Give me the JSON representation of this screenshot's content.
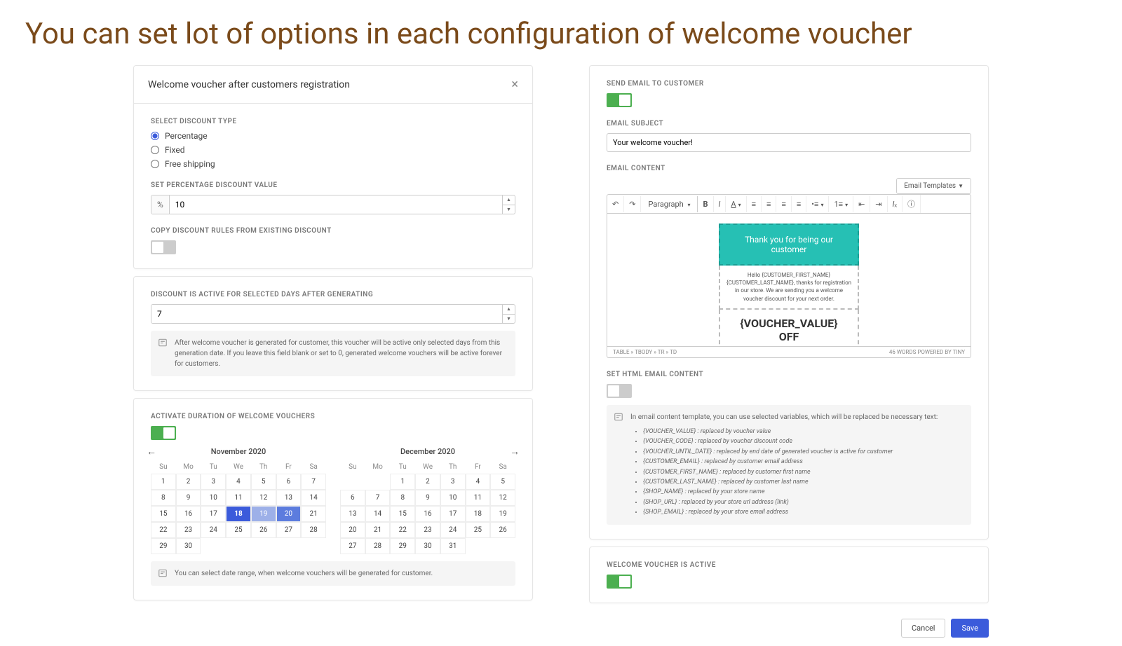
{
  "page_title": "You can set lot of options in each configuration of welcome voucher",
  "modal": {
    "title": "Welcome voucher after customers registration"
  },
  "discount": {
    "label_type": "SELECT DISCOUNT TYPE",
    "opt_percentage": "Percentage",
    "opt_fixed": "Fixed",
    "opt_free": "Free shipping",
    "label_value": "SET PERCENTAGE DISCOUNT VALUE",
    "prefix": "%",
    "value": "10",
    "label_copy": "COPY DISCOUNT RULES FROM EXISTING DISCOUNT"
  },
  "duration": {
    "label_days": "DISCOUNT IS ACTIVE FOR SELECTED DAYS AFTER GENERATING",
    "days_value": "7",
    "info": "After welcome voucher is generated for customer, this voucher will be active only selected days from this generation date. If you leave this field blank or set to 0, generated welcome vouchers will be active forever for customers."
  },
  "activate": {
    "label": "ACTIVATE DURATION OF WELCOME VOUCHERS",
    "month1": "November 2020",
    "month2": "December 2020",
    "dow": [
      "Su",
      "Mo",
      "Tu",
      "We",
      "Th",
      "Fr",
      "Sa"
    ],
    "info": "You can select date range, when welcome vouchers will be generated for customer."
  },
  "email": {
    "label_send": "SEND EMAIL TO CUSTOMER",
    "label_subject": "EMAIL SUBJECT",
    "subject": "Your welcome voucher!",
    "label_content": "EMAIL CONTENT",
    "templates_btn": "Email Templates",
    "paragraph": "Paragraph",
    "banner": "Thank you for being our customer",
    "body_line1": "Hello {CUSTOMER_FIRST_NAME}",
    "body_line2": "{CUSTOMER_LAST_NAME}, thanks for registration",
    "body_line3": "in our store. We are sending you a welcome",
    "body_line4": "voucher discount for your next order.",
    "voucher_line1": "{VOUCHER_VALUE}",
    "voucher_line2": "OFF",
    "footer_path": "TABLE » TBODY » TR » TD",
    "footer_meta": "46 WORDS  POWERED BY TINY",
    "label_html": "SET HTML EMAIL CONTENT",
    "vars_intro": "In email content template, you can use selected variables, which will be replaced be necessary text:",
    "vars": [
      "{VOUCHER_VALUE} : replaced by voucher value",
      "{VOUCHER_CODE} : replaced by voucher discount code",
      "{VOUCHER_UNTIL_DATE} : replaced by end date of generated voucher is active for customer",
      "{CUSTOMER_EMAIL} : replaced by customer email address",
      "{CUSTOMER_FIRST_NAME} : replaced by customer first name",
      "{CUSTOMER_LAST_NAME} : replaced by customer last name",
      "{SHOP_NAME} : replaced by your store name",
      "{SHOP_URL} : replaced by your store url address (link)",
      "{SHOP_EMAIL} : replaced by your store email address"
    ]
  },
  "active": {
    "label": "WELCOME VOUCHER IS ACTIVE"
  },
  "buttons": {
    "cancel": "Cancel",
    "save": "Save"
  }
}
